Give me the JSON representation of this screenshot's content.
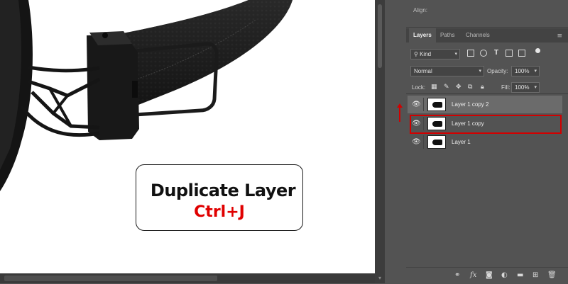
{
  "panel": {
    "align_label": "Align:",
    "tabs": [
      "Layers",
      "Paths",
      "Channels"
    ],
    "menu_icon": "hamburger-menu-icon"
  },
  "layers_panel": {
    "kind_filter": "Kind",
    "filter_icons": [
      "pixel-filter-icon",
      "adjustment-filter-icon",
      "type-filter-icon",
      "shape-filter-icon",
      "smart-object-filter-icon"
    ],
    "blend_mode": "Normal",
    "opacity_label": "Opacity:",
    "opacity_value": "100%",
    "lock_label": "Lock:",
    "lock_icons": [
      "lock-transparent-icon",
      "lock-image-icon",
      "lock-position-icon",
      "lock-artboard-icon",
      "lock-all-icon"
    ],
    "fill_label": "Fill:",
    "fill_value": "100%",
    "layers": [
      {
        "name": "Layer 1 copy 2",
        "visible": true,
        "selected": true
      },
      {
        "name": "Layer 1 copy",
        "visible": true,
        "selected": false,
        "highlighted": true
      },
      {
        "name": "Layer 1",
        "visible": true,
        "selected": false
      }
    ],
    "bottom_icons": [
      "link-layers-icon",
      "fx-icon",
      "add-mask-icon",
      "adjustment-layer-icon",
      "new-group-icon",
      "new-layer-icon",
      "delete-icon"
    ]
  },
  "callout": {
    "title": "Duplicate Layer",
    "shortcut": "Ctrl+J"
  },
  "colors": {
    "panel_bg": "#535353",
    "highlight_red": "#d10000",
    "shortcut_red": "#e00000",
    "selected_row": "#6b6b6b"
  }
}
